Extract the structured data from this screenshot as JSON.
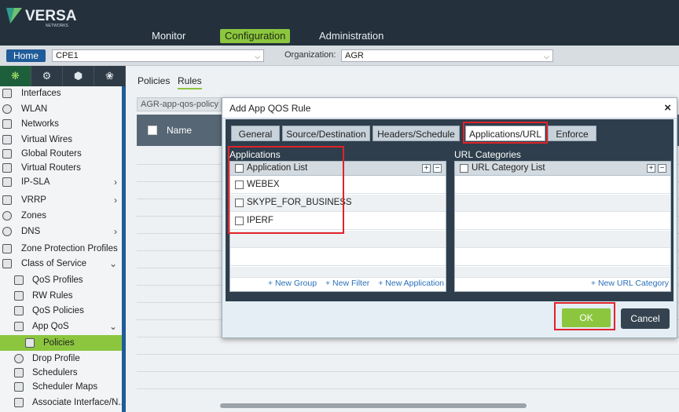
{
  "header": {
    "logo_text": "VERSA",
    "logo_sub": "NETWORKS",
    "nav": [
      "Monitor",
      "Configuration",
      "Administration"
    ]
  },
  "subbar": {
    "home_label": "Home",
    "appliance_value": "CPE1",
    "org_label": "Organization:",
    "org_value": "AGR"
  },
  "sidebar": {
    "items": [
      {
        "label": "Interfaces"
      },
      {
        "label": "WLAN"
      },
      {
        "label": "Networks"
      },
      {
        "label": "Virtual Wires"
      },
      {
        "label": "Global Routers"
      },
      {
        "label": "Virtual Routers"
      },
      {
        "label": "IP-SLA"
      },
      {
        "label": "VRRP"
      },
      {
        "label": "Zones"
      },
      {
        "label": "DNS"
      },
      {
        "label": "Zone Protection Profiles"
      },
      {
        "label": "Class of Service"
      },
      {
        "label": "QoS Profiles"
      },
      {
        "label": "RW Rules"
      },
      {
        "label": "QoS Policies"
      },
      {
        "label": "App QoS"
      },
      {
        "label": "Policies"
      },
      {
        "label": "Drop Profile"
      },
      {
        "label": "Schedulers"
      },
      {
        "label": "Scheduler Maps"
      },
      {
        "label": "Associate Interface/N..."
      }
    ]
  },
  "main": {
    "tabs": [
      "Policies",
      "Rules"
    ],
    "policy_name": "AGR-app-qos-policy",
    "grid_column_name": "Name"
  },
  "modal": {
    "title": "Add App QOS Rule",
    "close": "×",
    "tabs": [
      "General",
      "Source/Destination",
      "Headers/Schedule",
      "Applications/URL",
      "Enforce"
    ],
    "active_tab": "Applications/URL",
    "applications": {
      "title": "Applications",
      "list_header": "Application List",
      "rows": [
        "WEBEX",
        "SKYPE_FOR_BUSINESS",
        "IPERF"
      ],
      "links": [
        "+ New Group",
        "+ New Filter",
        "+ New Application"
      ]
    },
    "url_categories": {
      "title": "URL Categories",
      "list_header": "URL Category List",
      "links": [
        "+ New URL Category"
      ]
    },
    "ok_label": "OK",
    "cancel_label": "Cancel"
  },
  "colors": {
    "accent_green": "#8cc63f",
    "highlight_red": "#e0232a",
    "header_dark": "#24313d",
    "link_blue": "#2a70b8"
  }
}
